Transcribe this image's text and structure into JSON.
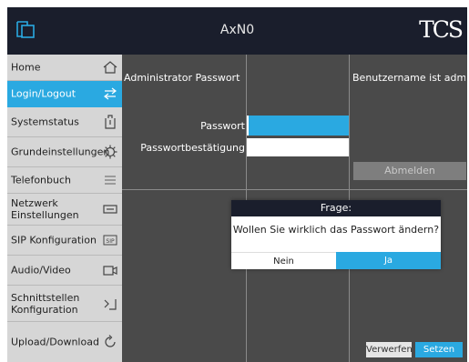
{
  "header": {
    "title": "AxN0",
    "brand": "TCS",
    "logo_icon": "window-icon"
  },
  "sidebar": {
    "items": [
      {
        "label": "Home",
        "icon": "home-icon",
        "active": false
      },
      {
        "label": "Login/Logout",
        "icon": "login-icon",
        "active": true
      },
      {
        "label": "Systemstatus",
        "icon": "clipboard-icon",
        "active": false
      },
      {
        "label": "Grundeinstellungen",
        "icon": "gear-icon",
        "active": false
      },
      {
        "label": "Telefonbuch",
        "icon": "list-icon",
        "active": false
      },
      {
        "label": "Netzwerk\nEinstellungen",
        "icon": "network-icon",
        "active": false
      },
      {
        "label": "SIP Konfiguration",
        "icon": "sip-icon",
        "active": false
      },
      {
        "label": "Audio/Video",
        "icon": "camera-icon",
        "active": false
      },
      {
        "label": "Schnittstellen\nKonfiguration",
        "icon": "interface-icon",
        "active": false
      },
      {
        "label": "Upload/Download",
        "icon": "refresh-icon",
        "active": false
      }
    ]
  },
  "main": {
    "admin_password_heading": "Administrator Passwort",
    "password_label": "Passwort",
    "password_value": "",
    "password_confirm_label": "Passwortbestätigung",
    "password_confirm_value": "",
    "username_info": "Benutzername ist admin",
    "logout_button": "Abmelden",
    "discard_button": "Verwerfen",
    "set_button": "Setzen"
  },
  "dialog": {
    "title": "Frage:",
    "message": "Wollen Sie wirklich das Passwort ändern?",
    "no_label": "Nein",
    "yes_label": "Ja"
  },
  "colors": {
    "accent": "#2aa9e1",
    "header_bg": "#1a1e2c",
    "content_bg": "#4a4a4a",
    "sidebar_bg": "#d6d6d6"
  }
}
